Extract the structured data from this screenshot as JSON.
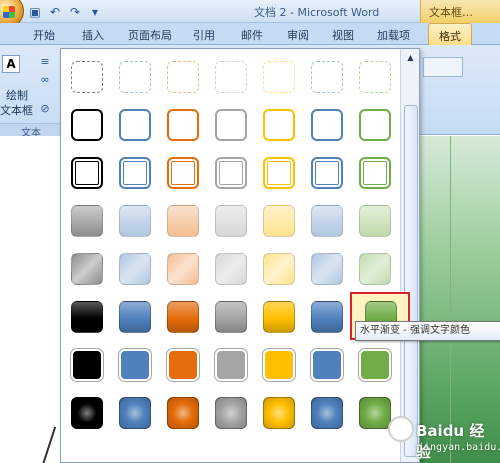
{
  "window": {
    "title": "文档 2 - Microsoft Word",
    "context_tab_title": "文本框…"
  },
  "quick_access": {
    "icons": [
      "save-icon",
      "undo-icon",
      "redo-icon",
      "customize-icon"
    ],
    "glyphs": [
      "▣",
      "↶",
      "↷",
      "▾"
    ]
  },
  "tabs": [
    {
      "label": "开始"
    },
    {
      "label": "插入"
    },
    {
      "label": "页面布局"
    },
    {
      "label": "引用"
    },
    {
      "label": "邮件"
    },
    {
      "label": "审阅"
    },
    {
      "label": "视图"
    },
    {
      "label": "加载项"
    },
    {
      "label": "格式",
      "active": true,
      "contextual": true
    }
  ],
  "ribbon": {
    "text_group": {
      "draw_label": "绘制",
      "textbox_label": "文本框",
      "group_name": "文本"
    }
  },
  "gallery": {
    "rows": 8,
    "columns": 7,
    "column_colors": [
      "#000000",
      "#4f81bd",
      "#e46c0a",
      "#a5a5a5",
      "#ffc000",
      "#4f81bd",
      "#70ad47"
    ],
    "selected": {
      "row": 5,
      "column": 6
    }
  },
  "tooltip": {
    "text": "水平渐变 - 强调文字颜色"
  },
  "watermark": {
    "brand": "Baidu 经验",
    "sub": "jingyan.baidu.com"
  }
}
